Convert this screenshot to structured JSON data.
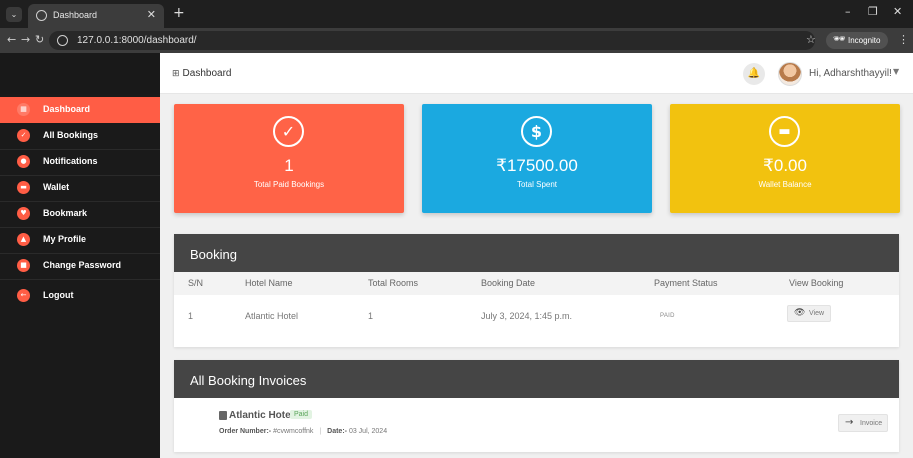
{
  "browser": {
    "tab_title": "Dashboard",
    "url": "127.0.0.1:8000/dashboard/",
    "incognito_label": "Incognito"
  },
  "header": {
    "title": "Dashboard",
    "greeting": "Hi, Adharshthayyil!"
  },
  "sidebar": {
    "items": [
      {
        "label": "Dashboard",
        "icon": "grid-icon",
        "active": true
      },
      {
        "label": "All Bookings",
        "icon": "check-icon"
      },
      {
        "label": "Notifications",
        "icon": "bell-icon"
      },
      {
        "label": "Wallet",
        "icon": "wallet-icon"
      },
      {
        "label": "Bookmark",
        "icon": "heart-icon"
      },
      {
        "label": "My Profile",
        "icon": "user-icon"
      },
      {
        "label": "Change Password",
        "icon": "lock-icon"
      },
      {
        "label": "Logout",
        "icon": "arrow-left-icon"
      }
    ]
  },
  "stats": [
    {
      "value": "1",
      "label": "Total Paid Bookings",
      "color": "#ff6347",
      "icon": "check-circle-icon"
    },
    {
      "value": "₹17500.00",
      "label": "Total Spent",
      "color": "#1ba9e0",
      "icon": "dollar-icon"
    },
    {
      "value": "₹0.00",
      "label": "Wallet Balance",
      "color": "#f2c20f",
      "icon": "wallet-icon"
    }
  ],
  "booking": {
    "title": "Booking",
    "columns": [
      "S/N",
      "Hotel Name",
      "Total Rooms",
      "Booking Date",
      "Payment Status",
      "View Booking"
    ],
    "rows": [
      {
        "sn": "1",
        "hotel": "Atlantic Hotel",
        "rooms": "1",
        "date": "July 3, 2024, 1:45 p.m.",
        "status": "PAID",
        "action": "View"
      }
    ]
  },
  "invoices": {
    "title": "All Booking Invoices",
    "items": [
      {
        "hotel": "Atlantic Hotel",
        "badge": "Paid",
        "order_label": "Order Number:-",
        "order_number": "#cvwmcoffnk",
        "date_label": "Date:-",
        "date": "03 Jul, 2024",
        "button": "Invoice"
      }
    ]
  }
}
